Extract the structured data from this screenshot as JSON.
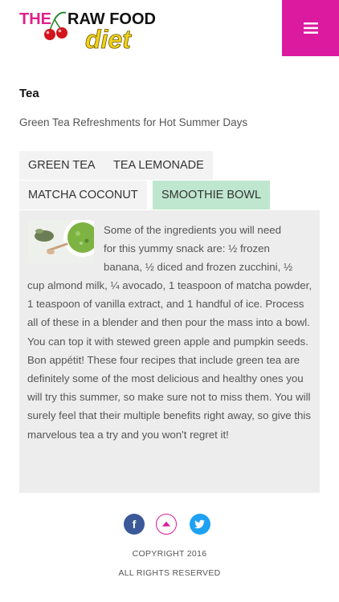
{
  "header": {
    "logo_text_the": "THE",
    "logo_text_raw_food": "RAW FOOD",
    "logo_text_diet": "diet",
    "menu_icon": "hamburger-menu-icon",
    "accent_color": "#db1a9f"
  },
  "page": {
    "title": "Tea",
    "subtitle": "Green Tea Refreshments for Hot Summer Days"
  },
  "tabs": [
    {
      "label": "GREEN TEA",
      "active": false
    },
    {
      "label": "TEA LEMONADE",
      "active": false
    },
    {
      "label": "MATCHA COCONUT",
      "active": false
    },
    {
      "label": "SMOOTHIE BOWL",
      "active": true
    }
  ],
  "content": {
    "image": "matcha-smoothie-bowl-photo",
    "text_lines_top": [
      "Some of the ingredients you will need",
      "for this yummy snack are: ½ frozen",
      "banana, ½ diced and frozen zucchini, ½"
    ],
    "text_rest": "cup almond milk, ¼ avocado, 1 teaspoon of matcha powder, 1 teaspoon of vanilla extract, and 1 handful of ice. Process all of these in a blender and then pour the mass into a bowl. You can top it with stewed green apple and pumpkin seeds. Bon appétit! These four recipes that include green tea are definitely some of the most delicious and healthy ones you will try this summer, so make sure not to miss them. You will surely feel that their multiple benefits right away, so give this marvelous tea a try and you won't regret it!"
  },
  "footer": {
    "social": [
      "facebook-icon",
      "scroll-to-top-icon",
      "twitter-icon"
    ],
    "copyright": "COPYRIGHT 2016",
    "rights": "ALL RIGHTS RESERVED"
  }
}
